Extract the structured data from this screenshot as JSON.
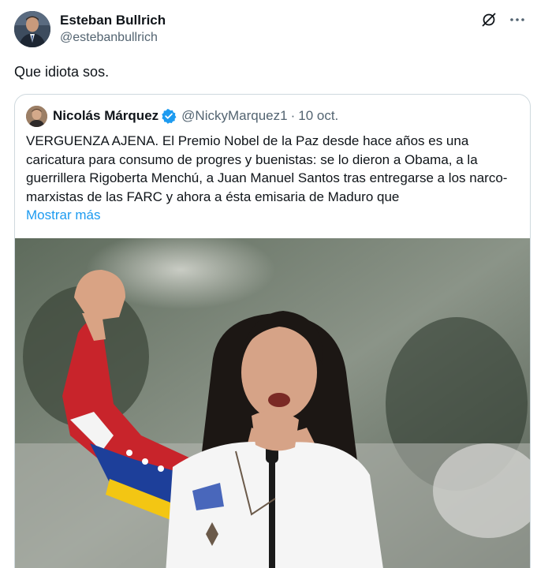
{
  "author": {
    "display_name": "Esteban Bullrich",
    "handle": "@estebanbullrich",
    "avatar_icon": "profile-photo"
  },
  "tweet": {
    "text": "Que idiota sos."
  },
  "top_icons": [
    "grok-icon",
    "more-icon"
  ],
  "quoted_tweet": {
    "display_name": "Nicolás Márquez",
    "verified": true,
    "handle": "@NickyMarquez1",
    "separator": "·",
    "date": "10 oct.",
    "text": "VERGUENZA AJENA. El Premio Nobel de la Paz desde hace años es una caricatura para consumo de progres y buenistas: se lo dieron a Obama, a la guerrillera Rigoberta Menchú, a Juan Manuel Santos tras entregarse a los narco-marxistas de las FARC y ahora a ésta emisaria de Maduro que",
    "show_more": "Mostrar más",
    "media_icon": "photo-woman-raising-fist-with-microphone"
  },
  "colors": {
    "text": "#0f1419",
    "muted": "#536471",
    "link": "#1d9bf0",
    "border": "#cfd9de",
    "verified": "#1d9bf0"
  }
}
